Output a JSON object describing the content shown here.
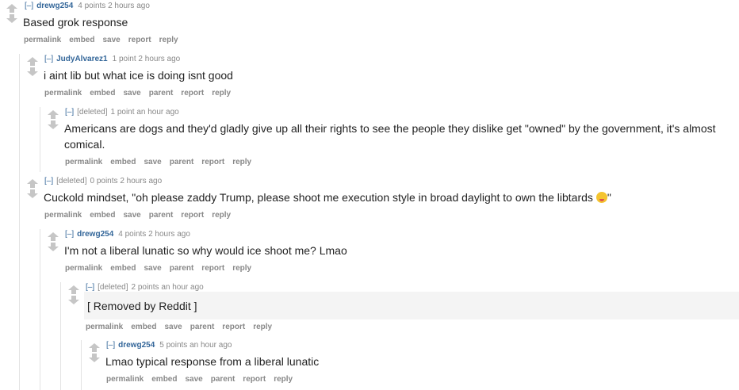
{
  "expand_label": "[–]",
  "buttons": {
    "permalink": "permalink",
    "embed": "embed",
    "save": "save",
    "parent": "parent",
    "report": "report",
    "reply": "reply"
  },
  "comments": [
    {
      "author": "drewg254",
      "points": "4 points",
      "time": "2 hours ago",
      "body": "Based grok response"
    },
    {
      "author": "JudyAlvarez1",
      "points": "1 point",
      "time": "2 hours ago",
      "body": "i aint lib but what ice is doing isnt good"
    },
    {
      "author": "[deleted]",
      "points": "1 point",
      "time": "an hour ago",
      "body": "Americans are dogs and they'd gladly give up all their rights to see the people they dislike get \"owned\" by the government, it's almost comical."
    },
    {
      "author": "[deleted]",
      "points": "0 points",
      "time": "2 hours ago",
      "body": "Cuckold mindset, \"oh please zaddy Trump, please shoot me execution style in broad daylight to own the libtards",
      "body_end": "\"",
      "emoji": "zany-face"
    },
    {
      "author": "drewg254",
      "points": "4 points",
      "time": "2 hours ago",
      "body": "I'm not a liberal lunatic so why would ice shoot me? Lmao"
    },
    {
      "author": "[deleted]",
      "points": "2 points",
      "time": "an hour ago",
      "body": "[ Removed by Reddit ]"
    },
    {
      "author": "drewg254",
      "points": "5 points",
      "time": "an hour ago",
      "body": "Lmao typical response from a liberal lunatic"
    }
  ]
}
